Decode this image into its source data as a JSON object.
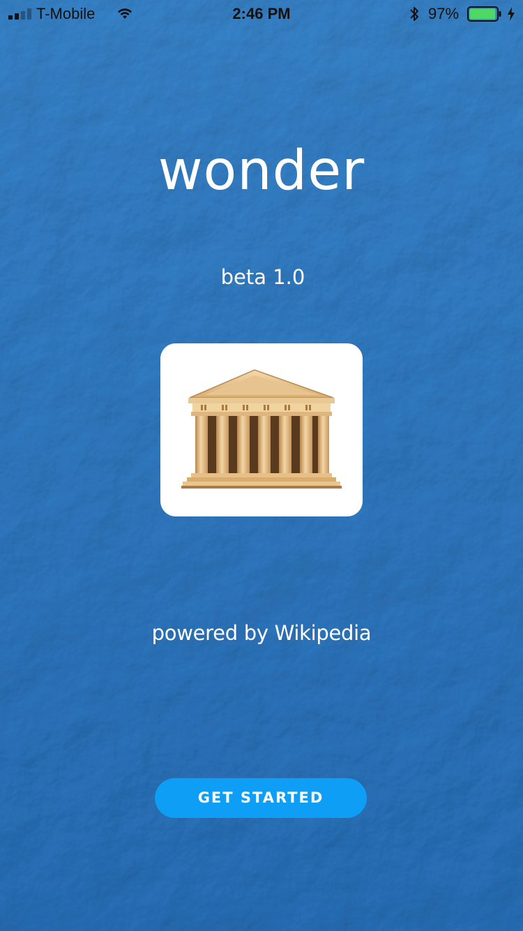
{
  "status_bar": {
    "carrier": "T-Mobile",
    "time": "2:46 PM",
    "battery_percent": "97%",
    "battery_level": 0.97,
    "signal_bars_filled": 2,
    "signal_bars_total": 4,
    "icons": [
      "signal-icon",
      "wifi-icon",
      "bluetooth-icon",
      "battery-icon",
      "charging-bolt-icon"
    ]
  },
  "splash": {
    "title": "wonder",
    "version": "beta 1.0",
    "logo_icon": "greek-temple-icon",
    "powered_by": "powered by Wikipedia",
    "cta_label": "GET STARTED"
  },
  "colors": {
    "background": "#2e7cc6",
    "button": "#0f9ef5",
    "battery_fill": "#4cd964",
    "text": "#ffffff"
  }
}
